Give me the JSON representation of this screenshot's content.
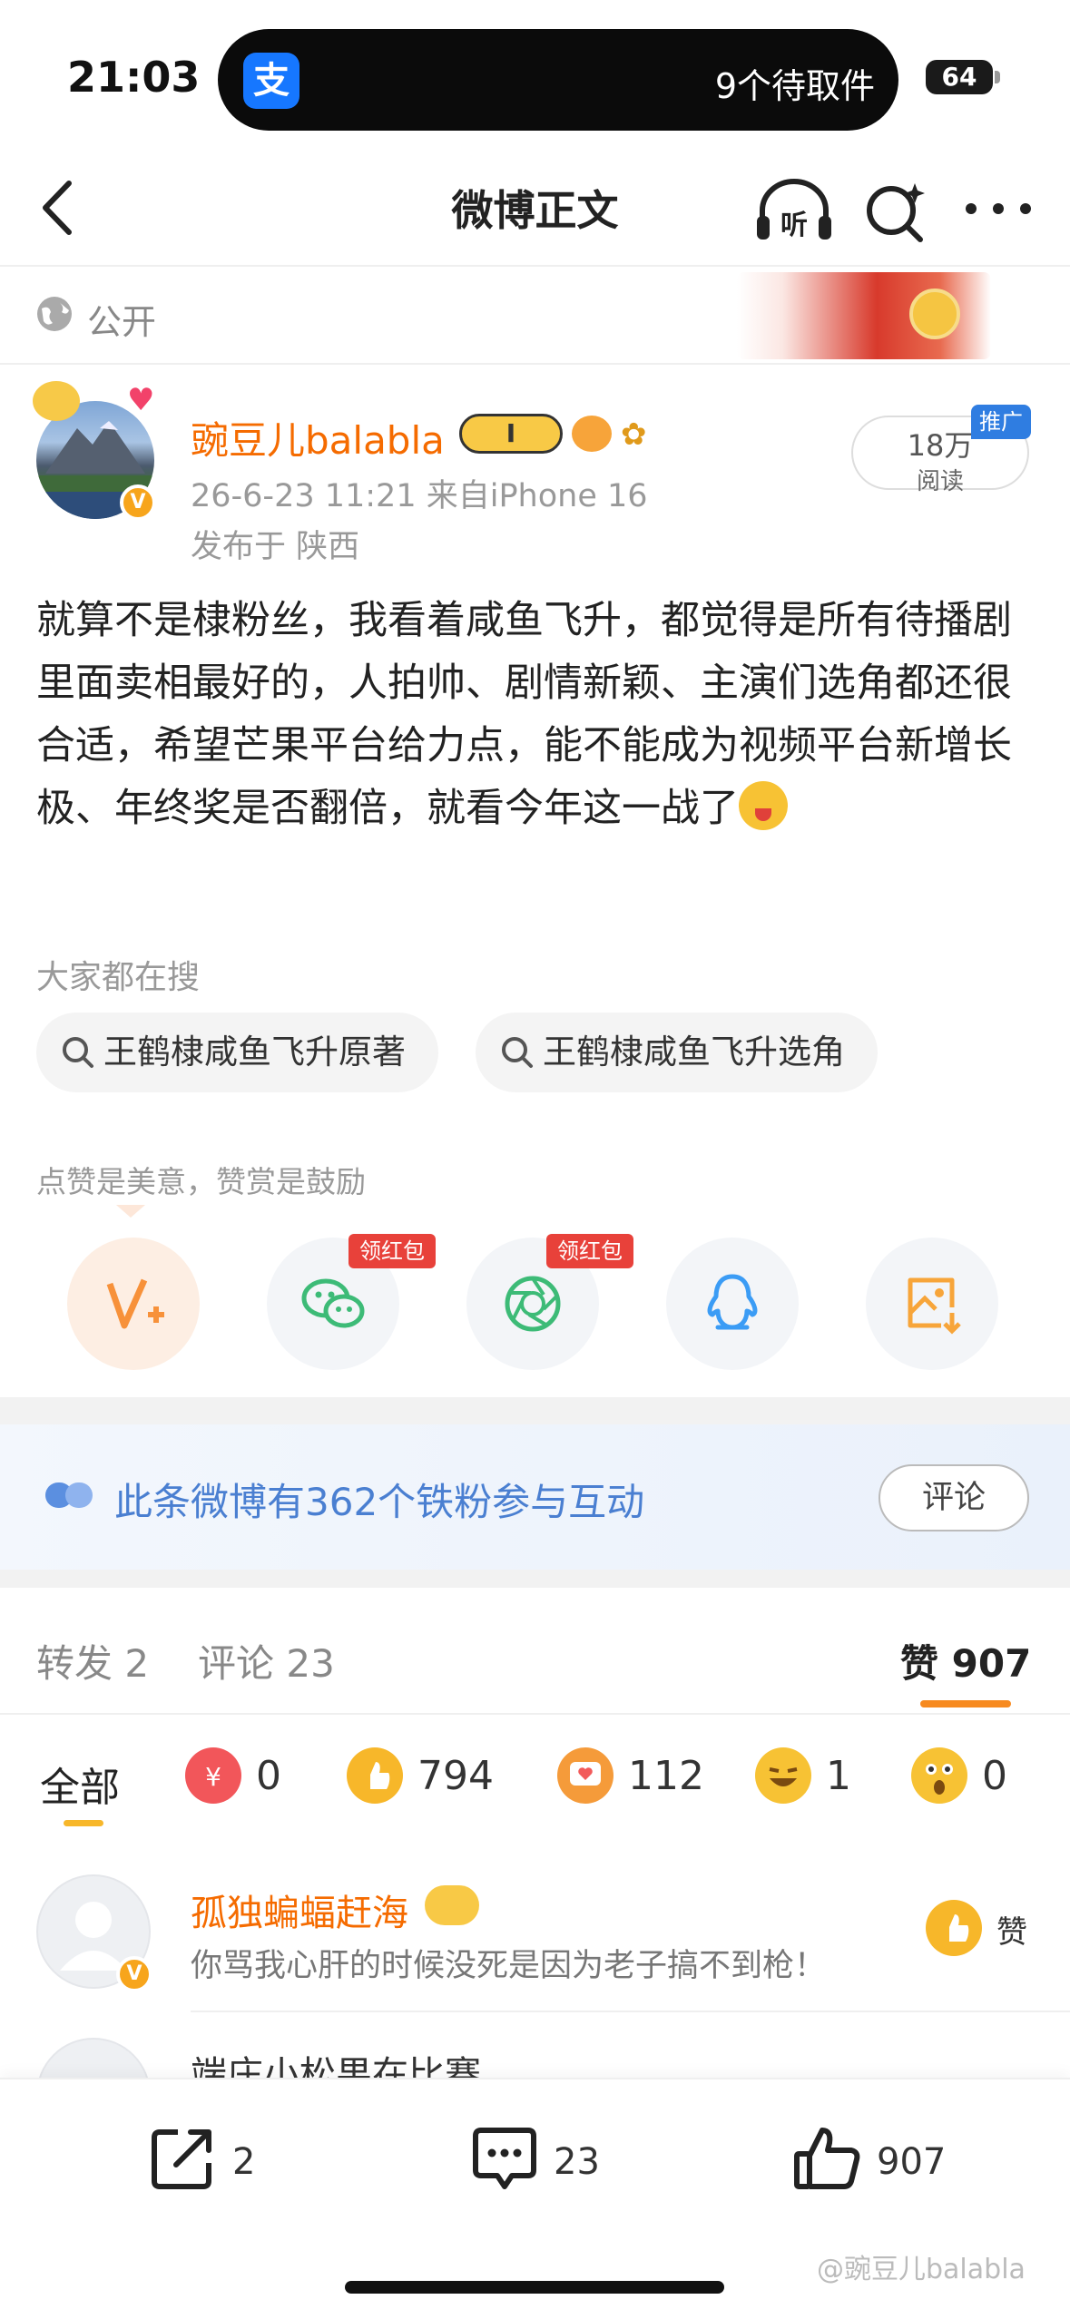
{
  "status_bar": {
    "time": "21:03",
    "alipay_icon": "支",
    "live_activity_text": "9个待取件",
    "battery": "64"
  },
  "nav": {
    "title": "微博正文",
    "listen_label": "听"
  },
  "visibility": {
    "label": "公开"
  },
  "post": {
    "username": "豌豆儿balabla",
    "member_badge": "I",
    "date_source": "26-6-23 11:21  来自iPhone 16",
    "location": "发布于 陕西",
    "reads": {
      "count": "18万",
      "label": "阅读",
      "promo_tag": "推广"
    },
    "text": "就算不是棣粉丝，我看着咸鱼飞升，都觉得是所有待播剧里面卖相最好的，人拍帅、剧情新颖、主演们选角都还很合适，希望芒果平台给力点，能不能成为视频平台新增长极、年终奖是否翻倍，就看今年这一战了",
    "verified_badge": "V"
  },
  "hot_search": {
    "title": "大家都在搜",
    "chips": [
      "王鹤棣咸鱼飞升原著",
      "王鹤棣咸鱼飞升选角"
    ]
  },
  "share": {
    "praise_text": "点赞是美意，赞赏是鼓励",
    "redpacket_label": "领红包",
    "buttons": [
      "v-plus-icon",
      "wechat-icon",
      "moments-icon",
      "qq-icon",
      "save-image-icon"
    ]
  },
  "fans": {
    "text": "此条微博有362个铁粉参与互动",
    "comment_button": "评论"
  },
  "tabs": {
    "repost": "转发 2",
    "comment": "评论 23",
    "like": "赞 907"
  },
  "reactions": {
    "all": "全部",
    "items": [
      {
        "name": "reward",
        "count": "0",
        "color": "#f2565a"
      },
      {
        "name": "thumbs-up",
        "count": "794",
        "color": "#f7b72a"
      },
      {
        "name": "heart",
        "count": "112",
        "color": "#f59b3a"
      },
      {
        "name": "laugh",
        "count": "1",
        "color": "#f7c234"
      },
      {
        "name": "surprise",
        "count": "0",
        "color": "#f7c234"
      }
    ]
  },
  "comments": [
    {
      "name": "孤独蝙蝠赶海",
      "text": "你骂我心肝的时候没死是因为老子搞不到枪！",
      "like_label": "赞"
    },
    {
      "name": "端庄小松果在比赛"
    }
  ],
  "bottom_bar": {
    "repost_count": "2",
    "comment_count": "23",
    "like_count": "907"
  },
  "watermark": "@豌豆儿balabla",
  "colors": {
    "accent": "#f78a1f",
    "username": "#f56b00",
    "link_blue": "#4a7fd1"
  }
}
